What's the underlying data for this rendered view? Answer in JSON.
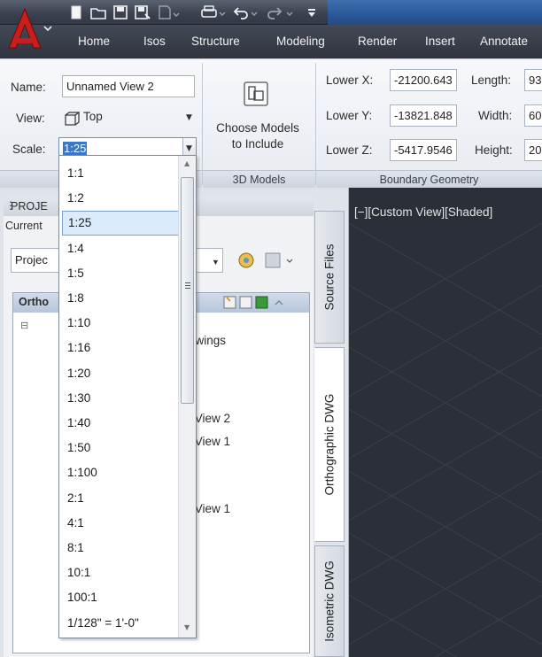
{
  "ribbon_tabs": [
    "Home",
    "Isos",
    "Structure",
    "Modeling",
    "Render",
    "Insert",
    "Annotate"
  ],
  "quick_access_icons": [
    "new-icon",
    "open-icon",
    "save-icon",
    "save-as-icon",
    "plot-preview-icon",
    "print-icon",
    "undo-icon",
    "redo-icon",
    "qat-menu-icon"
  ],
  "view_panel": {
    "name_label": "Name:",
    "name_value": "Unnamed View 2",
    "view_label": "View:",
    "view_value": "Top",
    "scale_label": "Scale:",
    "scale_value": "1:25"
  },
  "models_panel": {
    "button_label": "Choose Models to Include",
    "button_line1": "Choose Models",
    "button_line2": "to Include",
    "panel_title": "3D Models"
  },
  "boundary_panel": {
    "lower_x_label": "Lower X:",
    "lower_x_value": "-21200.643",
    "lower_y_label": "Lower Y:",
    "lower_y_value": "-13821.848",
    "lower_z_label": "Lower Z:",
    "lower_z_value": "-5417.9546",
    "length_label": "Length:",
    "length_value": "93",
    "width_label": "Width:",
    "width_value": "60",
    "height_label": "Height:",
    "height_value": "20",
    "panel_title": "Boundary Geometry"
  },
  "palette": {
    "title": "PROJE",
    "current_label": "Current",
    "project_combo": "Projec",
    "section_title": "Ortho",
    "tree_items": [
      "awings",
      "l View 2",
      "l View 1",
      "l View 1"
    ],
    "tabs": [
      "Source Files",
      "Orthographic DWG",
      "Isometric DWG"
    ]
  },
  "viewport": {
    "label": "[−][Custom View][Shaded]"
  },
  "scale_dropdown": {
    "options": [
      "1:1",
      "1:2",
      "1:25",
      "1:4",
      "1:5",
      "1:8",
      "1:10",
      "1:16",
      "1:20",
      "1:30",
      "1:40",
      "1:50",
      "1:100",
      "2:1",
      "4:1",
      "8:1",
      "10:1",
      "100:1",
      "1/128\" = 1'-0\""
    ],
    "selected": "1:25"
  },
  "colors": {
    "title_bar": "#3c4250",
    "ribbon_bg": "#eef1f5",
    "viewport_bg": "#2b3038",
    "selection": "#dcebfb",
    "app_button_red": "#c81e1e"
  }
}
